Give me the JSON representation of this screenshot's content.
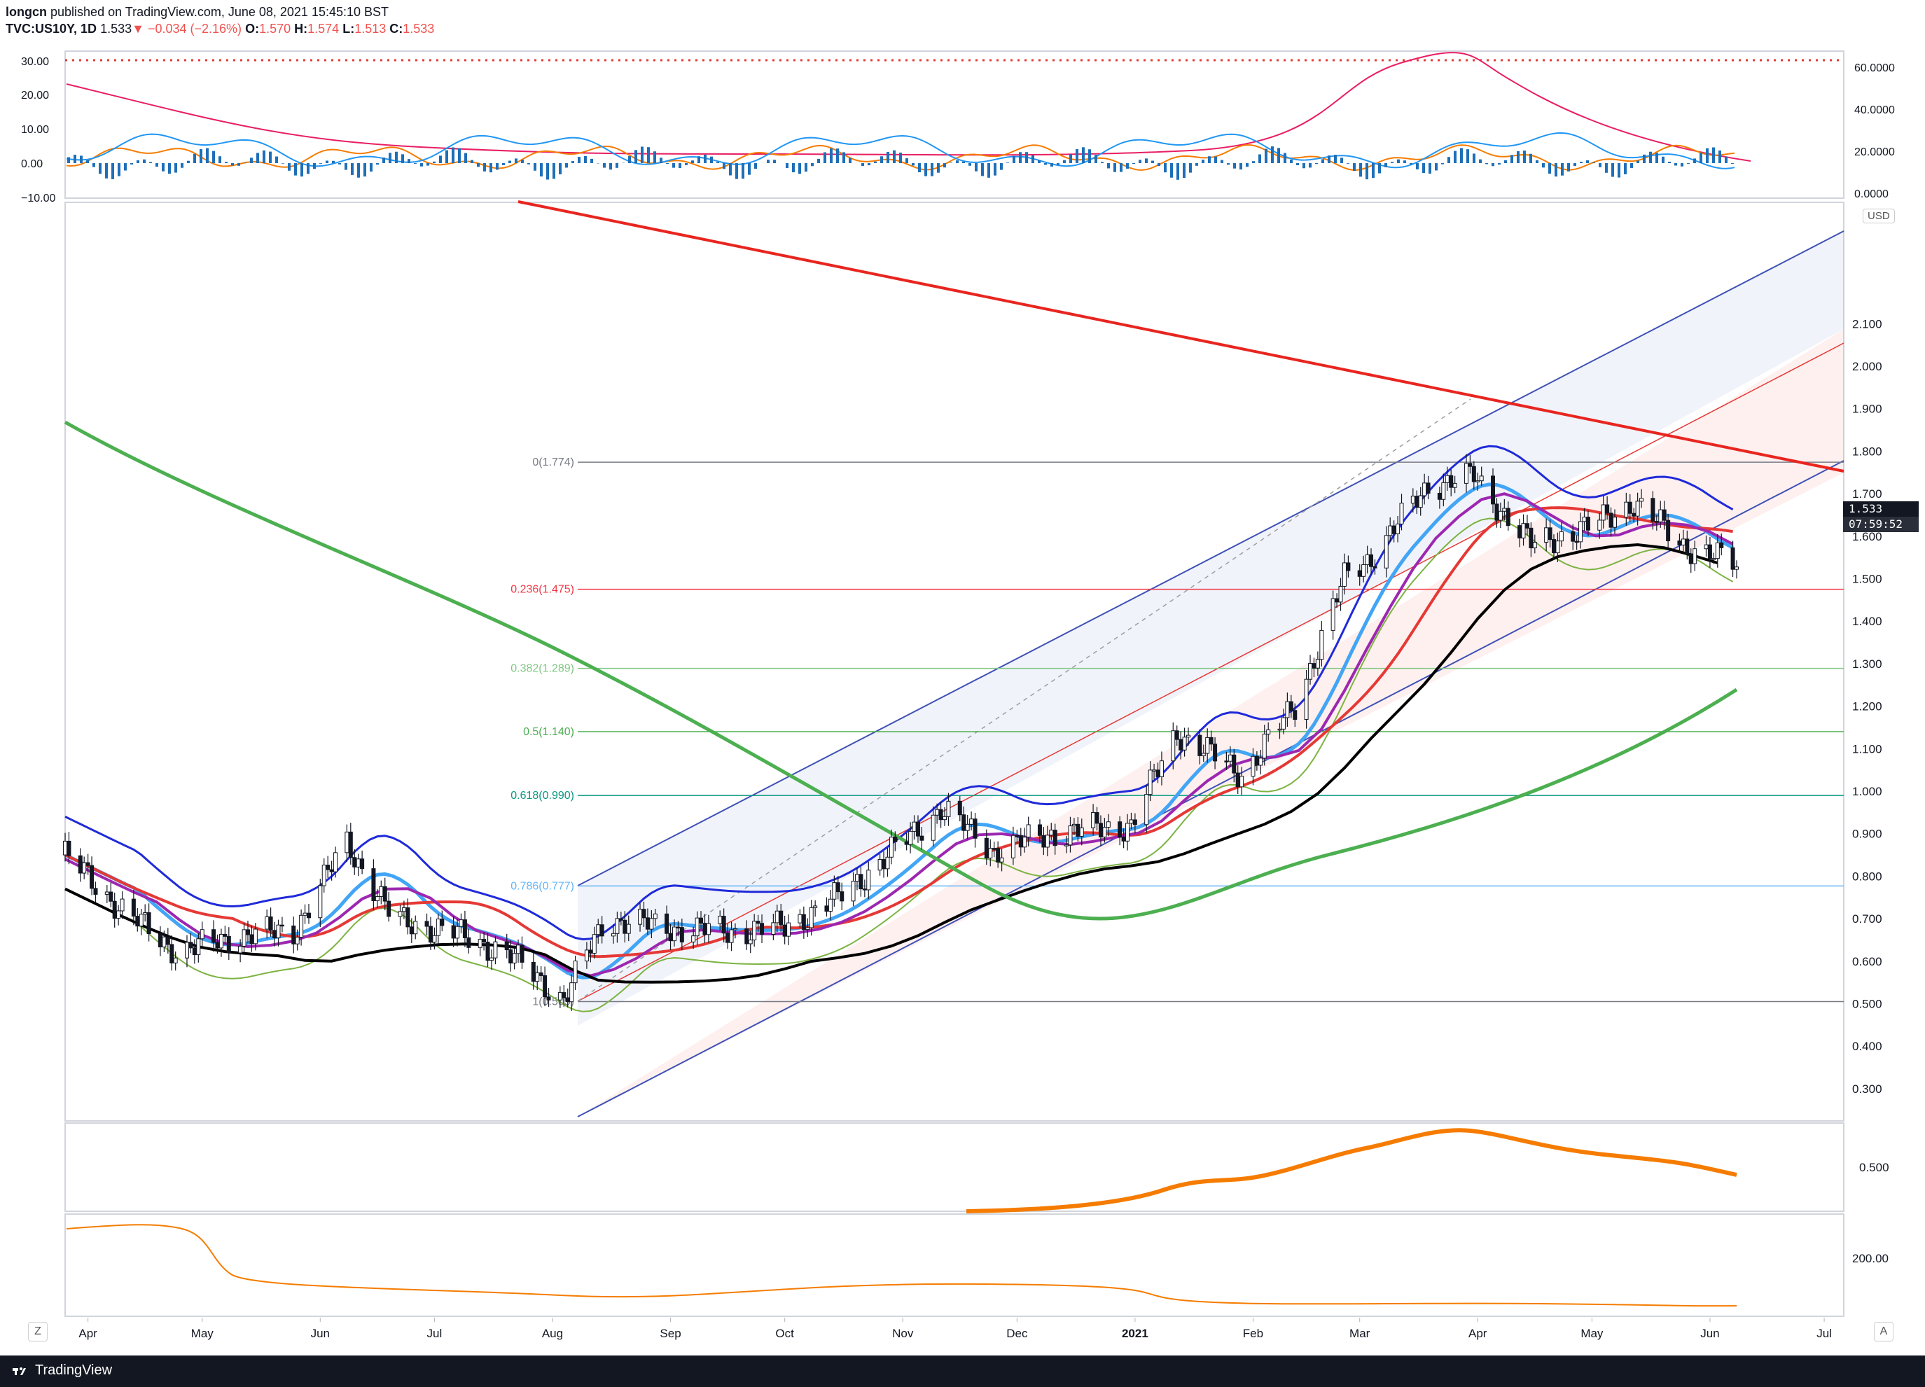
{
  "header": {
    "publisher": "longcn",
    "published_text": "published on TradingView.com, June 08, 2021 15:45:10 BST",
    "symbol": "TVC:US10Y, 1D",
    "last": "1.533",
    "change": "−0.034 (−2.16%)",
    "o_label": "O:",
    "o_val": "1.570",
    "h_label": "H:",
    "h_val": "1.574",
    "l_label": "L:",
    "l_val": "1.513",
    "c_label": "C:",
    "c_val": "1.533"
  },
  "price_axis": {
    "currency": "USD",
    "ticks": [
      "2.100",
      "2.000",
      "1.900",
      "1.800",
      "1.700",
      "1.600",
      "1.500",
      "1.400",
      "1.300",
      "1.200",
      "1.100",
      "1.000",
      "0.900",
      "0.800",
      "0.700",
      "0.600",
      "0.500",
      "0.400",
      "0.300"
    ],
    "last_price_label": "1.533",
    "countdown_label": "07:59:52"
  },
  "top_panel": {
    "left_ticks": [
      "30.00",
      "20.00",
      "10.00",
      "0.00",
      "−10.00"
    ],
    "right_ticks": [
      "60.0000",
      "40.0000",
      "20.0000",
      "0.0000"
    ]
  },
  "osc_panel": {
    "right_ticks": [
      "0.500"
    ]
  },
  "bottom_panel": {
    "right_ticks": [
      "200.00"
    ]
  },
  "time_axis": {
    "labels": [
      "Apr",
      "May",
      "Jun",
      "Jul",
      "Aug",
      "Sep",
      "Oct",
      "Nov",
      "Dec",
      "2021",
      "Feb",
      "Mar",
      "Apr",
      "May",
      "Jun",
      "Jul"
    ],
    "left_button": "Z",
    "right_button": "A"
  },
  "fibonacci": [
    {
      "label": "0(1.774)",
      "price": 1.774,
      "color": "#787b86"
    },
    {
      "label": "0.236(1.475)",
      "price": 1.475,
      "color": "#f23645"
    },
    {
      "label": "0.382(1.289)",
      "price": 1.289,
      "color": "#81c784"
    },
    {
      "label": "0.5(1.140)",
      "price": 1.14,
      "color": "#4caf50"
    },
    {
      "label": "0.618(0.990)",
      "price": 0.99,
      "color": "#089981"
    },
    {
      "label": "0.786(0.777)",
      "price": 0.777,
      "color": "#64b5f6"
    },
    {
      "label": "1(0.505)",
      "price": 0.505,
      "color": "#787b86"
    }
  ],
  "chart_data": {
    "type": "candlestick",
    "symbol": "TVC:US10Y",
    "interval": "1D",
    "unit": "USD",
    "y_range": [
      0.24,
      2.2
    ],
    "last_price": 1.533,
    "open": 1.57,
    "high": 1.574,
    "low": 1.513,
    "close": 1.533,
    "price_trend": [
      {
        "date": "2020-03-26",
        "price": 0.85
      },
      {
        "date": "2020-04-10",
        "price": 0.72
      },
      {
        "date": "2020-04-25",
        "price": 0.62
      },
      {
        "date": "2020-05-10",
        "price": 0.66
      },
      {
        "date": "2020-05-25",
        "price": 0.67
      },
      {
        "date": "2020-06-08",
        "price": 0.88
      },
      {
        "date": "2020-06-20",
        "price": 0.7
      },
      {
        "date": "2020-07-05",
        "price": 0.67
      },
      {
        "date": "2020-07-20",
        "price": 0.62
      },
      {
        "date": "2020-08-04",
        "price": 0.51
      },
      {
        "date": "2020-08-15",
        "price": 0.7
      },
      {
        "date": "2020-08-30",
        "price": 0.68
      },
      {
        "date": "2020-09-15",
        "price": 0.67
      },
      {
        "date": "2020-10-01",
        "price": 0.68
      },
      {
        "date": "2020-10-15",
        "price": 0.75
      },
      {
        "date": "2020-10-31",
        "price": 0.87
      },
      {
        "date": "2020-11-11",
        "price": 0.96
      },
      {
        "date": "2020-11-25",
        "price": 0.86
      },
      {
        "date": "2020-12-10",
        "price": 0.9
      },
      {
        "date": "2020-12-31",
        "price": 0.92
      },
      {
        "date": "2021-01-12",
        "price": 1.14
      },
      {
        "date": "2021-01-29",
        "price": 1.04
      },
      {
        "date": "2021-02-12",
        "price": 1.2
      },
      {
        "date": "2021-02-25",
        "price": 1.5
      },
      {
        "date": "2021-03-05",
        "price": 1.56
      },
      {
        "date": "2021-03-19",
        "price": 1.72
      },
      {
        "date": "2021-03-31",
        "price": 1.74
      },
      {
        "date": "2021-04-15",
        "price": 1.58
      },
      {
        "date": "2021-04-30",
        "price": 1.62
      },
      {
        "date": "2021-05-12",
        "price": 1.68
      },
      {
        "date": "2021-05-25",
        "price": 1.58
      },
      {
        "date": "2021-06-08",
        "price": 1.533
      }
    ]
  },
  "colors": {
    "up": "#ffffff",
    "down": "#131722",
    "trendline": "#e8251f",
    "bollinger": "#1f2ad9",
    "sma200": "#4caf50",
    "ema_red": "#e53935",
    "ma_blue": "#42a5f5",
    "kijun_purple": "#9c27b0",
    "black_step": "#000000",
    "orange": "#f57c00"
  }
}
